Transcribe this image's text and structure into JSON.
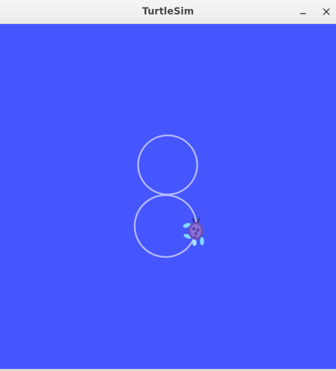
{
  "window": {
    "title": "TurtleSim",
    "controls": {
      "minimize_icon": "minimize-icon",
      "close_icon": "close-icon"
    }
  },
  "canvas": {
    "background_color": "#4556ff",
    "pen_color": "#b3b8ff",
    "turtle_name": "turtle-icon"
  }
}
